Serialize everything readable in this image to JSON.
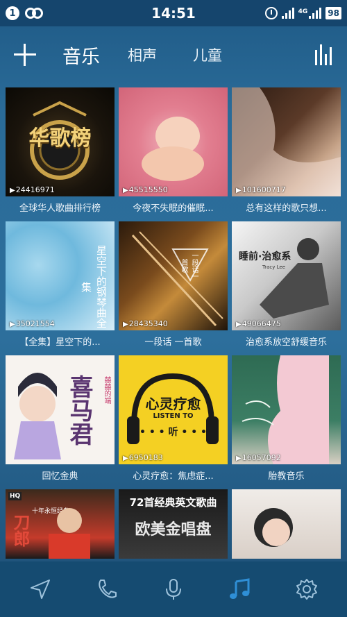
{
  "status": {
    "notif_badge": "1",
    "time": "14:51",
    "network": "4G",
    "battery": "98"
  },
  "tabs": [
    {
      "label": "音乐",
      "active": true
    },
    {
      "label": "相声",
      "active": false
    },
    {
      "label": "儿童",
      "active": false
    },
    {
      "label": "?",
      "active": false
    }
  ],
  "albums": [
    {
      "title": "全球华人歌曲排行榜",
      "plays": "24416971",
      "cover_text": "华歌榜"
    },
    {
      "title": "今夜不失眠的催眠...",
      "plays": "45515550",
      "cover_text": ""
    },
    {
      "title": "总有这样的歌只想...",
      "plays": "101600717",
      "cover_text": ""
    },
    {
      "title": "【全集】星空下的...",
      "plays": "35021554",
      "cover_text": "星空下的钢琴曲全集"
    },
    {
      "title": "一段话 一首歌",
      "plays": "28435340",
      "cover_text": "一段话一首歌"
    },
    {
      "title": "治愈系放空舒缓音乐",
      "plays": "49066475",
      "cover_text": "睡前·治愈系"
    },
    {
      "title": "回忆金典",
      "plays": "",
      "cover_text": "喜马君"
    },
    {
      "title": "心灵疗愈：焦虑症...",
      "plays": "6950183",
      "cover_text": "心灵疗愈"
    },
    {
      "title": "胎教音乐",
      "plays": "16057092",
      "cover_text": ""
    },
    {
      "title": "",
      "plays": "",
      "cover_text": "刀郎"
    },
    {
      "title": "",
      "plays": "",
      "cover_text": "72首经典英文歌曲"
    },
    {
      "title": "",
      "plays": "",
      "cover_text": ""
    }
  ],
  "cover_extras": {
    "album5_sub": "Tracy Lee",
    "album8_listen": "LISTEN TO",
    "album8_dots": "• • • 听 • • •",
    "album11_sub": "欧美金唱盘",
    "album10_badge": "HQ",
    "album10_sub": "十年永恒经典",
    "album7_side": "囍囍的端"
  },
  "nav": [
    "send-icon",
    "phone-icon",
    "mic-icon",
    "music-icon",
    "settings-icon"
  ],
  "accent": "#2f8fd6"
}
